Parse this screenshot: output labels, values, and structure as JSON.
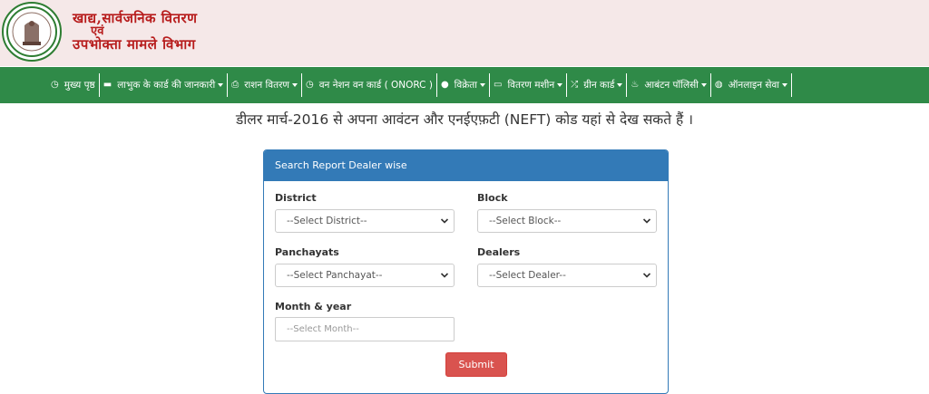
{
  "header": {
    "line1": "खाद्य,सार्वजनिक वितरण",
    "line2": "एवं",
    "line3": "उपभोक्ता मामले विभाग",
    "emblem_icon": "state-emblem-icon"
  },
  "nav": {
    "items": [
      {
        "label": "मुख्य पृष्ठ",
        "icon": "clock-icon",
        "dropdown": false
      },
      {
        "label": "लाभुक के कार्ड की जानकारी",
        "icon": "card-icon",
        "dropdown": true
      },
      {
        "label": "राशन वितरण",
        "icon": "print-icon",
        "dropdown": true
      },
      {
        "label": "वन नेशन वन कार्ड ( ONORC )",
        "icon": "clock-icon",
        "dropdown": false
      },
      {
        "label": "विक्रेता",
        "icon": "user-icon",
        "dropdown": true
      },
      {
        "label": "वितरण मशीन",
        "icon": "laptop-icon",
        "dropdown": true
      },
      {
        "label": "ग्रीन कार्ड",
        "icon": "shuffle-icon",
        "dropdown": true
      },
      {
        "label": "आबंटन पॉलिसी",
        "icon": "fire-icon",
        "dropdown": true
      },
      {
        "label": "ऑनलाइन सेवा",
        "icon": "globe-icon",
        "dropdown": true
      }
    ]
  },
  "headline": "डीलर मार्च-2016 से अपना आवंटन और एनईएफ़टी (NEFT) कोड यहां से देख सकते हैं ।",
  "panel": {
    "title": "Search Report Dealer wise",
    "district_label": "District",
    "district_value": "--Select District--",
    "block_label": "Block",
    "block_value": "--Select Block--",
    "panchayat_label": "Panchayats",
    "panchayat_value": "--Select Panchayat--",
    "dealer_label": "Dealers",
    "dealer_value": "--Select Dealer--",
    "month_label": "Month & year",
    "month_placeholder": "--Select Month--",
    "submit_label": "Submit"
  },
  "colors": {
    "nav_bg": "#2f8a48",
    "panel_head": "#337ab7",
    "submit_bg": "#d9534f",
    "title_red": "#b71c1c"
  }
}
